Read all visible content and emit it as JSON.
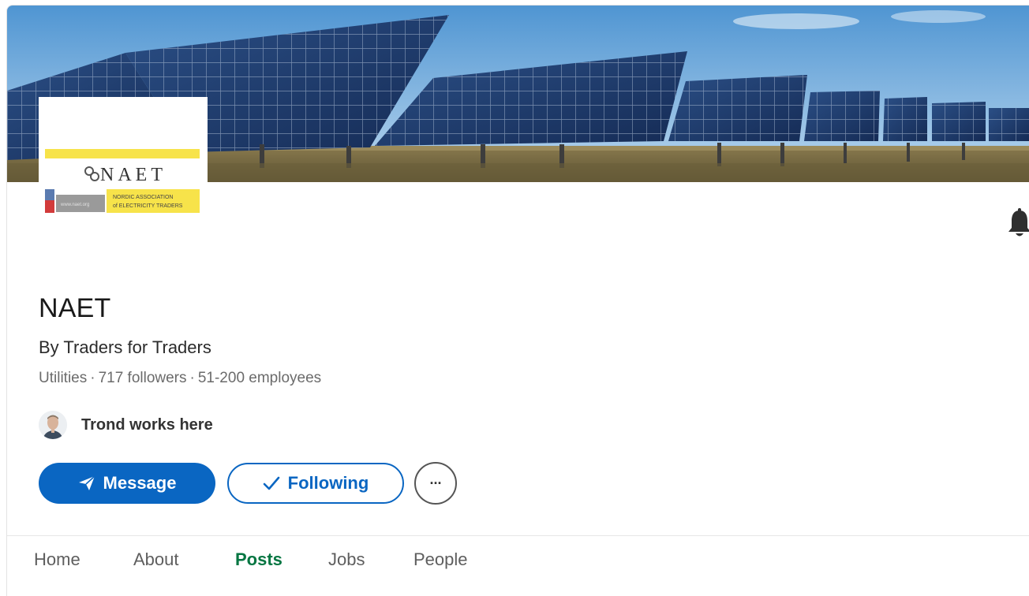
{
  "company": {
    "name": "NAET",
    "tagline": "By Traders for Traders",
    "industry": "Utilities",
    "followers": "717 followers",
    "employees": "51-200 employees",
    "separator": "·"
  },
  "logo": {
    "wordmark": "NAET",
    "line1": "NORDIC ASSOCIATION",
    "line2": "of ELECTRICITY TRADERS",
    "site": "www.naet.org"
  },
  "connection": {
    "text": "Trond works here"
  },
  "actions": {
    "message_label": "Message",
    "following_label": "Following",
    "more_label": "···"
  },
  "tabs": [
    {
      "label": "Home",
      "active": false
    },
    {
      "label": "About",
      "active": false
    },
    {
      "label": "Posts",
      "active": true
    },
    {
      "label": "Jobs",
      "active": false
    },
    {
      "label": "People",
      "active": false
    }
  ],
  "colors": {
    "primary": "#0a66c2",
    "active_tab": "#057642",
    "logo_yellow": "#f7e34a"
  },
  "icons": {
    "bell": "bell-icon",
    "message": "send-icon",
    "following": "checkmark-icon",
    "more": "ellipsis-icon"
  }
}
